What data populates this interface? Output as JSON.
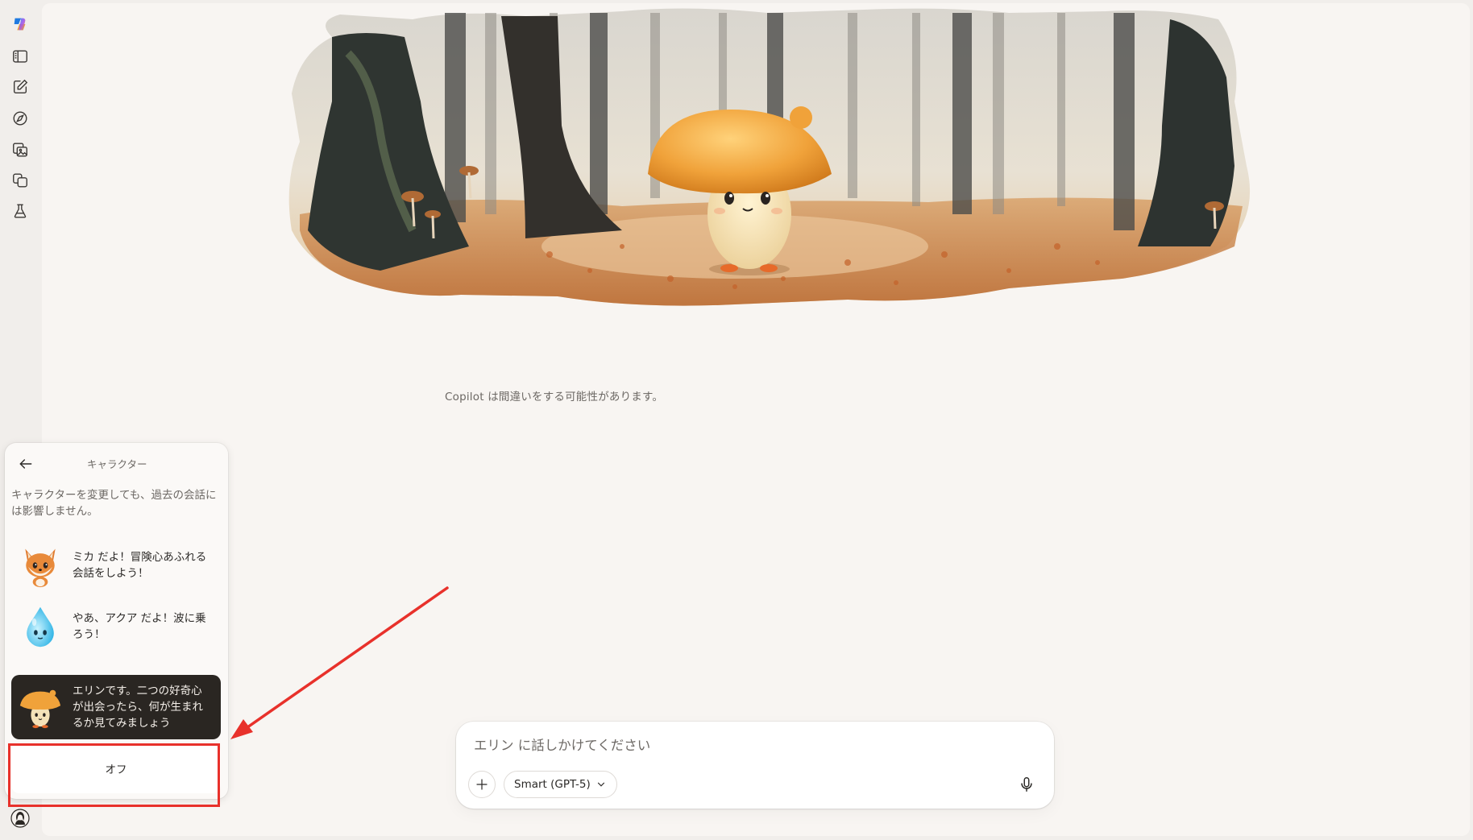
{
  "rail": {
    "items": [
      {
        "name": "copilot-logo-icon"
      },
      {
        "name": "sidebar-toggle-icon"
      },
      {
        "name": "new-chat-icon"
      },
      {
        "name": "discover-icon"
      },
      {
        "name": "image-gallery-icon"
      },
      {
        "name": "pages-icon"
      },
      {
        "name": "labs-icon"
      }
    ]
  },
  "main": {
    "disclaimer": "Copilot は間違いをする可能性があります。"
  },
  "composer": {
    "placeholder": "エリン に話しかけてください",
    "model_label": "Smart (GPT-5)"
  },
  "panel": {
    "title": "キャラクター",
    "description": "キャラクターを変更しても、過去の会話には影響しません。",
    "characters": [
      {
        "text": "ミカ だよ！冒険心あふれる会話をしよう！",
        "selected": false,
        "avatar": "fox-avatar-icon"
      },
      {
        "text": "やあ、アクア だよ！波に乗ろう！",
        "selected": false,
        "avatar": "water-drop-avatar-icon"
      },
      {
        "text": "エリンです。二つの好奇心が出会ったら、何が生まれるか見てみましょう",
        "selected": true,
        "avatar": "mushroom-avatar-icon"
      }
    ],
    "off_label": "オフ"
  },
  "colors": {
    "background": "#f1eeeb",
    "canvas": "#f8f5f2",
    "selected_item": "#2a2622",
    "annotation_red": "#e8312b"
  }
}
